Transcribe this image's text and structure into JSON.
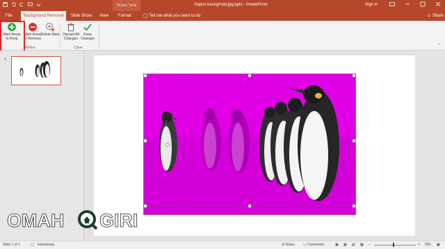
{
  "titlebar": {
    "context_tools": "Picture Tools",
    "document_title": "hapus backgrndd.jpg.pptx - PowerPoint",
    "sign_in": "Sign in"
  },
  "tabs": {
    "file": "File",
    "background_removal": "Background Removal",
    "slide_show": "Slide Show",
    "view": "View",
    "format": "Format",
    "tell_me": "Tell me what you want to do",
    "share": "Share"
  },
  "ribbon": {
    "mark_keep": "Mark Areas to Keep",
    "mark_remove": "Mark Areas to Remove",
    "delete_mark": "Delete Mark",
    "discard_all": "Discard All Changes",
    "keep_changes": "Keep Changes",
    "group_refine": "Refine",
    "group_close": "Close"
  },
  "slide_pane": {
    "slide_number": "1"
  },
  "statusbar": {
    "slide_info": "Slide 1 of 1",
    "language": "Indonesian",
    "notes": "Notes",
    "comments": "Comments",
    "zoom": "78%"
  },
  "watermark": {
    "left": "OMAH",
    "right": "GIRI"
  },
  "colors": {
    "accent": "#b7472a",
    "removal_overlay": "#e100e6",
    "highlight_box": "#e0232a"
  }
}
